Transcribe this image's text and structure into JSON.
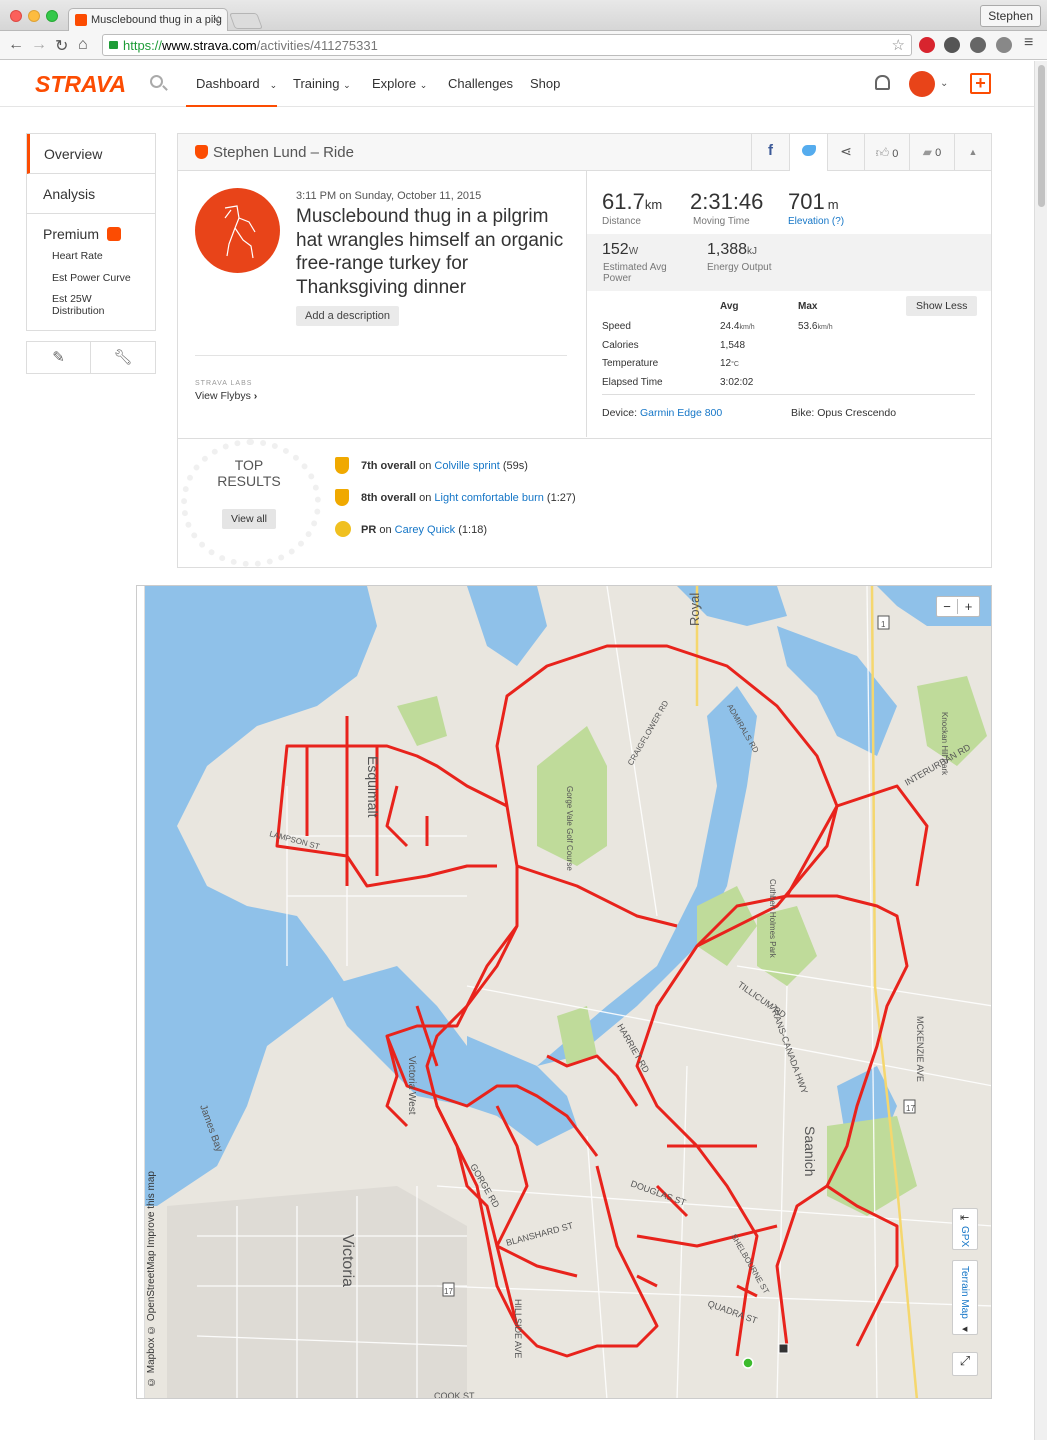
{
  "browser": {
    "tab_title": "Musclebound thug in a pilg",
    "url_https": "https://",
    "url_host": "www.strava.com",
    "url_path": "/activities/411275331",
    "profile": "Stephen"
  },
  "nav": {
    "logo": "STRAVA",
    "items": [
      {
        "label": "Dashboard",
        "caret": true
      },
      {
        "label": "Training",
        "caret": true
      },
      {
        "label": "Explore",
        "caret": true
      },
      {
        "label": "Challenges"
      },
      {
        "label": "Shop"
      }
    ],
    "plus": "+"
  },
  "sidebar": {
    "overview": "Overview",
    "analysis": "Analysis",
    "premium": "Premium",
    "sub": [
      "Heart Rate",
      "Est Power Curve",
      "Est 25W Distribution"
    ]
  },
  "activity": {
    "header": "Stephen Lund – Ride",
    "kudos": "0",
    "comments": "0",
    "date": "3:11 PM on Sunday, October 11, 2015",
    "title": "Musclebound thug in a pilgrim hat wrangles himself an organic free-range turkey for Thanksgiving dinner",
    "add_description": "Add a description",
    "labs": "STRAVA LABS",
    "view_flybys": "View Flybys",
    "distance": {
      "value": "61.7",
      "unit": "km",
      "label": "Distance"
    },
    "moving_time": {
      "value": "2:31:46",
      "label": "Moving Time"
    },
    "elevation": {
      "value": "701",
      "unit": "m",
      "label": "Elevation (?)"
    },
    "power": {
      "value": "152",
      "unit": "W",
      "label1": "Estimated Avg",
      "label2": "Power"
    },
    "energy": {
      "value": "1,388",
      "unit": "kJ",
      "label": "Energy Output"
    },
    "table": {
      "avg_header": "Avg",
      "max_header": "Max",
      "show_less": "Show Less",
      "rows": [
        {
          "label": "Speed",
          "avg": "24.4",
          "avg_unit": "km/h",
          "max": "53.6",
          "max_unit": "km/h"
        },
        {
          "label": "Calories",
          "avg": "1,548"
        },
        {
          "label": "Temperature",
          "avg": "12",
          "avg_unit": "°C"
        },
        {
          "label": "Elapsed Time",
          "avg": "3:02:02"
        }
      ]
    },
    "device_label": "Device:",
    "device": "Garmin Edge 800",
    "bike": "Bike: Opus Crescendo"
  },
  "results": {
    "heading1": "TOP",
    "heading2": "RESULTS",
    "view_all": "View all",
    "items": [
      {
        "rank": "7th overall",
        "on": "on",
        "segment": "Colville sprint",
        "time": "(59s)",
        "color": "#f0a900"
      },
      {
        "rank": "8th overall",
        "on": "on",
        "segment": "Light comfortable burn",
        "time": "(1:27)",
        "color": "#f0a900"
      },
      {
        "rank": "PR",
        "on": "on",
        "segment": "Carey Quick",
        "time": "(1:18)",
        "color": "#f0c020"
      }
    ]
  },
  "map": {
    "zoom_out": "−",
    "zoom_in": "+",
    "gpx": "GPX",
    "terrain": "Terrain Map",
    "attribution": "© Mapbox © OpenStreetMap  Improve this map",
    "labels": {
      "victoria": "Victoria",
      "saanich": "Saanich",
      "esquimalt": "Esquimalt",
      "royal": "Royal",
      "victoria_west": "Victoria West",
      "james_bay": "James Bay",
      "gorge_vale": "Gorge Vale Golf Course",
      "cuthbert": "Cuthbert Holmes Park",
      "knockan": "Knockan Hill Park",
      "harriet": "HARRIET RD",
      "tillicum": "TILLICUM RD",
      "douglas": "DOUGLAS ST",
      "quadra": "QUADRA ST",
      "cook": "COOK ST",
      "mckenzie": "MCKENZIE AVE",
      "interurban": "INTERURBAN RD",
      "admirals": "ADMIRALS RD",
      "trans_canada": "TRANS-CANADA HWY",
      "hillside": "HILLSIDE AVE",
      "blanshard": "BLANSHARD ST",
      "gorge": "GORGE RD",
      "craigflower": "CRAIGFLOWER RD",
      "lampson": "LAMPSON ST",
      "shelbourne": "SHELBOURNE ST",
      "route1": "1",
      "route17": "17"
    },
    "route_color": "#e8231c"
  }
}
